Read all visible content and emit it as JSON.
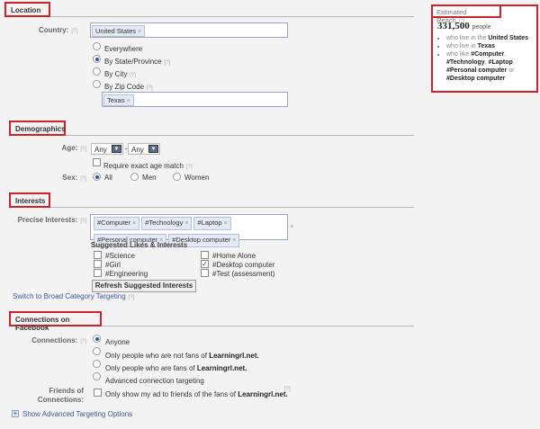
{
  "location": {
    "title": "Location",
    "country_label": "Country:",
    "help": "[?]",
    "country_token": "United States",
    "remove": "×",
    "options": [
      "Everywhere",
      "By State/Province",
      "By City",
      "By Zip Code"
    ],
    "selected": 1,
    "state_token": "Texas"
  },
  "demographics": {
    "title": "Demographics",
    "age_label": "Age:",
    "age_min": "Any",
    "age_max": "Any",
    "age_sep": "-",
    "exact_age_label": "Require exact age match",
    "sex_label": "Sex:",
    "sex_options": [
      "All",
      "Men",
      "Women"
    ],
    "sex_selected": 0
  },
  "interests": {
    "title": "Interests",
    "precise_label": "Precise Interests:",
    "tokens": [
      "#Computer",
      "#Technology",
      "#Laptop",
      "#Personal computer",
      "#Desktop computer"
    ],
    "plus": "+",
    "suggested_title": "Suggested Likes & Interests",
    "suggested_col1": [
      {
        "label": "#Science",
        "checked": false
      },
      {
        "label": "#Girl",
        "checked": false
      },
      {
        "label": "#Engineering",
        "checked": false
      }
    ],
    "suggested_col2": [
      {
        "label": "#Home Alone",
        "checked": false
      },
      {
        "label": "#Desktop computer",
        "checked": true
      },
      {
        "label": "#Test (assessment)",
        "checked": false
      }
    ],
    "refresh_button": "Refresh Suggested Interests",
    "switch_link": "Switch to Broad Category Targeting"
  },
  "connections": {
    "title": "Connections on Facebook",
    "label": "Connections:",
    "options_prefix": [
      "Anyone",
      "Only people who are not fans of ",
      "Only people who are fans of ",
      "Advanced connection targeting"
    ],
    "page_name": "Learningrl.net.",
    "selected": 0,
    "friends_label_1": "Friends of",
    "friends_label_2": "Connections:",
    "friends_option_prefix": "Only show my ad to friends of the fans of ",
    "show_advanced": "Show Advanced Targeting Options"
  },
  "reach": {
    "title": "Estimated Reach",
    "help": "[?]",
    "count": "331,500",
    "unit": "people",
    "line1_prefix": "who live in the ",
    "line1_bold": "United States",
    "line2_prefix": "who live in ",
    "line2_bold": "Texas",
    "line3_prefix": "who like ",
    "line3_bold1": "#Computer",
    "line3_bold2": "#Technology",
    "line3_bold3": "#Laptop",
    "line3_bold4": "#Personal computer",
    "line3_or": "or",
    "line3_bold5": "#Desktop computer"
  }
}
